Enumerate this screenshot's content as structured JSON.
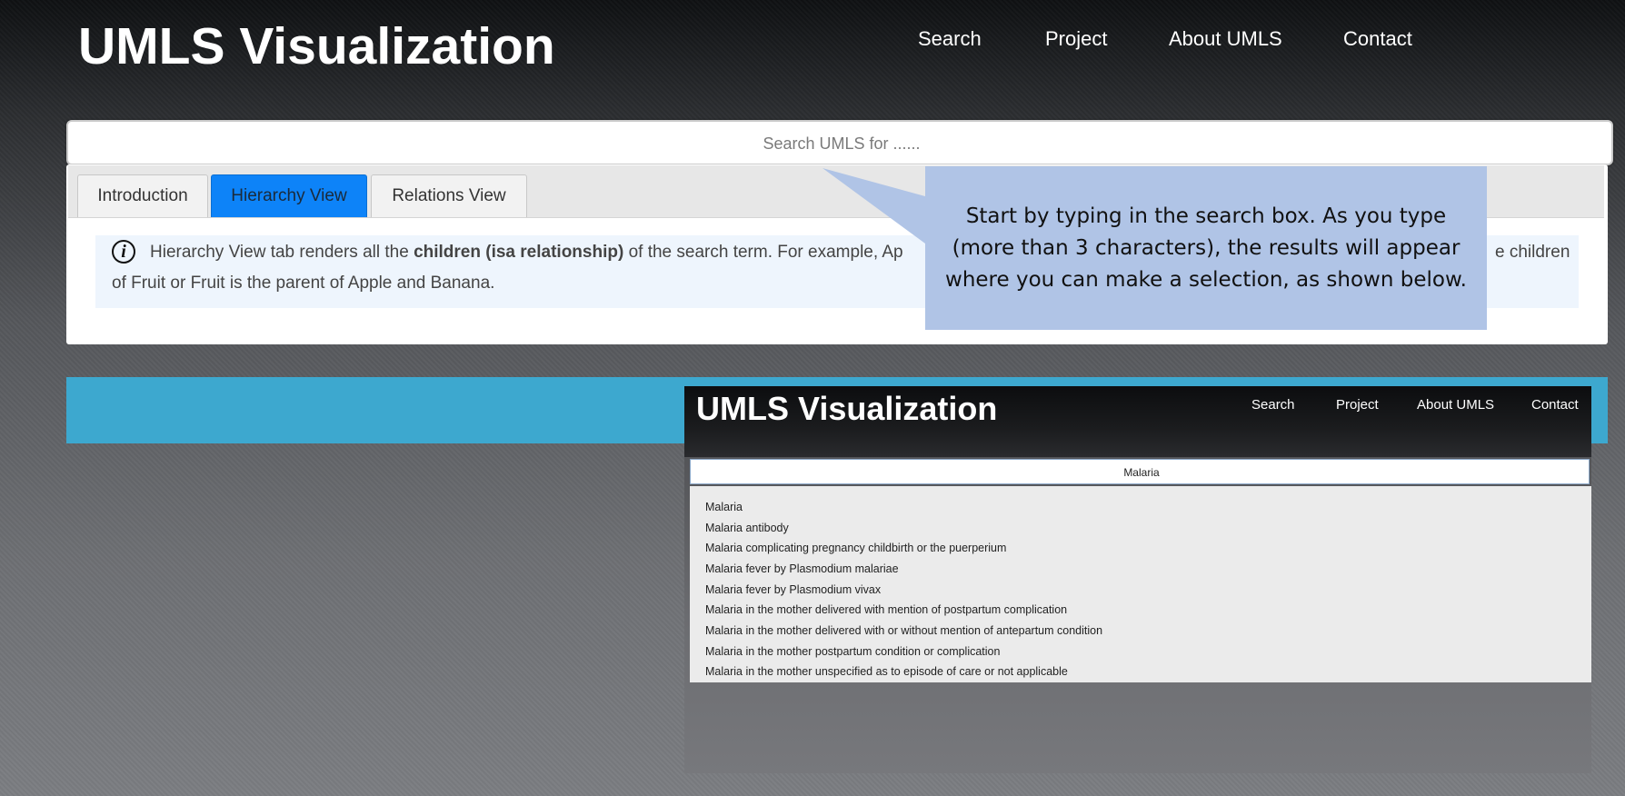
{
  "header": {
    "brand": "UMLS Visualization",
    "nav": [
      "Search",
      "Project",
      "About UMLS",
      "Contact"
    ]
  },
  "search": {
    "placeholder": "Search UMLS for ......",
    "value": ""
  },
  "tabs": [
    {
      "label": "Introduction",
      "active": false
    },
    {
      "label": "Hierarchy View",
      "active": true
    },
    {
      "label": "Relations View",
      "active": false
    }
  ],
  "info": {
    "icon": "info-icon",
    "line1_pre": "Hierarchy View tab renders all the ",
    "line1_bold": "children (isa relationship)",
    "line1_post": " of the search term. For example, Ap",
    "line1_tail": "e children",
    "line2": "of Fruit or Fruit is the parent of Apple and Banana."
  },
  "callout": {
    "text": "Start by typing in the search box. As you type (more than 3 characters), the results will appear where you can make a selection, as shown below."
  },
  "screenshot": {
    "brand": "UMLS Visualization",
    "nav": [
      "Search",
      "Project",
      "About UMLS",
      "Contact"
    ],
    "search_value": "Malaria",
    "results": [
      "Malaria",
      "Malaria antibody",
      "Malaria complicating pregnancy childbirth or the puerperium",
      "Malaria fever by Plasmodium malariae",
      "Malaria fever by Plasmodium vivax",
      "Malaria in the mother delivered with mention of postpartum complication",
      "Malaria in the mother delivered with or without mention of antepartum condition",
      "Malaria in the mother postpartum condition or complication",
      "Malaria in the mother unspecified as to episode of care or not applicable"
    ]
  },
  "colors": {
    "active_tab": "#0d83f8",
    "blue_bar": "#3da8cf",
    "callout": "#b0c4e6"
  }
}
